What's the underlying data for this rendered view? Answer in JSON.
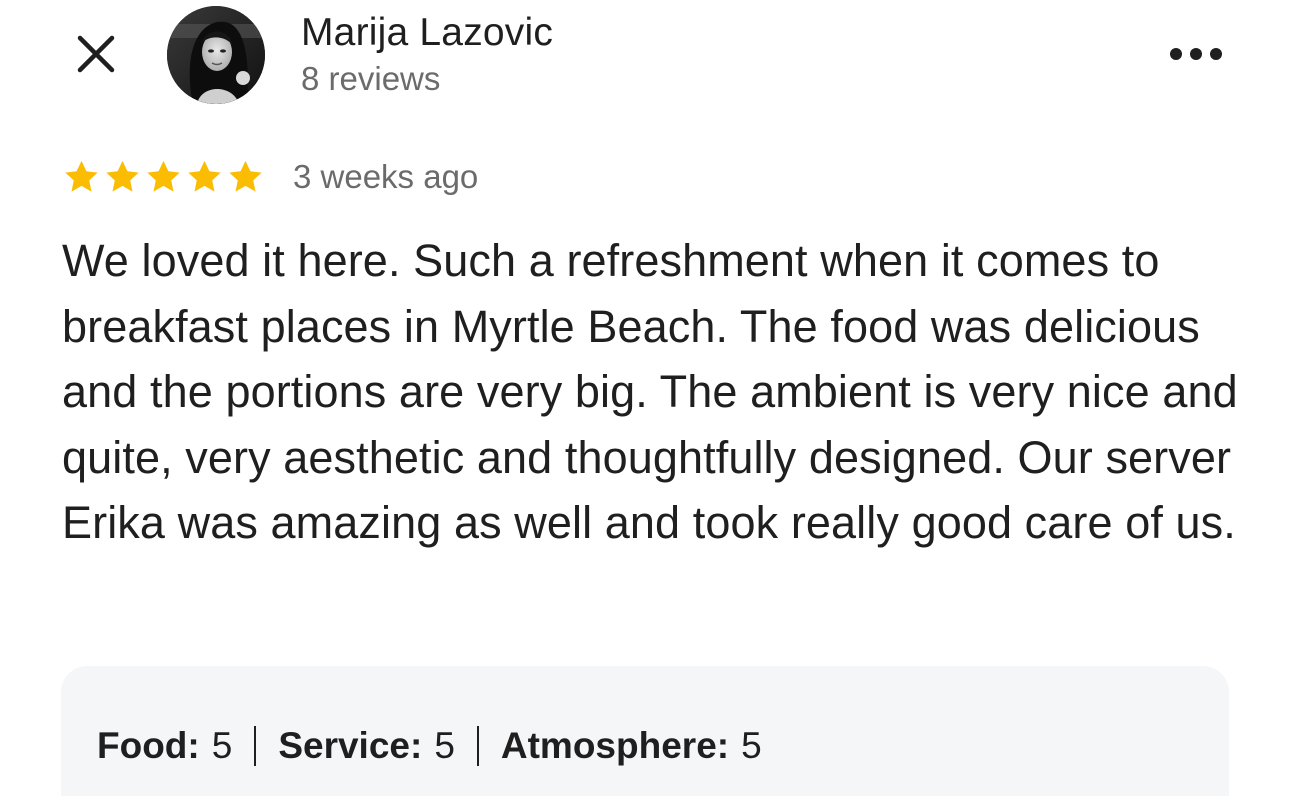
{
  "header": {
    "author_name": "Marija Lazovic",
    "review_count": "8 reviews",
    "close_icon": "close-icon",
    "more_icon": "more-horizontal-icon"
  },
  "review": {
    "rating": 5,
    "rating_max": 5,
    "star_color": "#fbbc04",
    "time_ago": "3 weeks ago",
    "text": "We loved it here. Such a refreshment when it comes to breakfast places in Myrtle Beach. The food was delicious and the portions are very big. The ambient is very nice and quite, very aesthetic and thoughtfully designed. Our server Erika was amazing as well and took really good care of us."
  },
  "attributes": [
    {
      "label": "Food:",
      "value": "5"
    },
    {
      "label": "Service:",
      "value": "5"
    },
    {
      "label": "Atmosphere:",
      "value": "5"
    }
  ]
}
